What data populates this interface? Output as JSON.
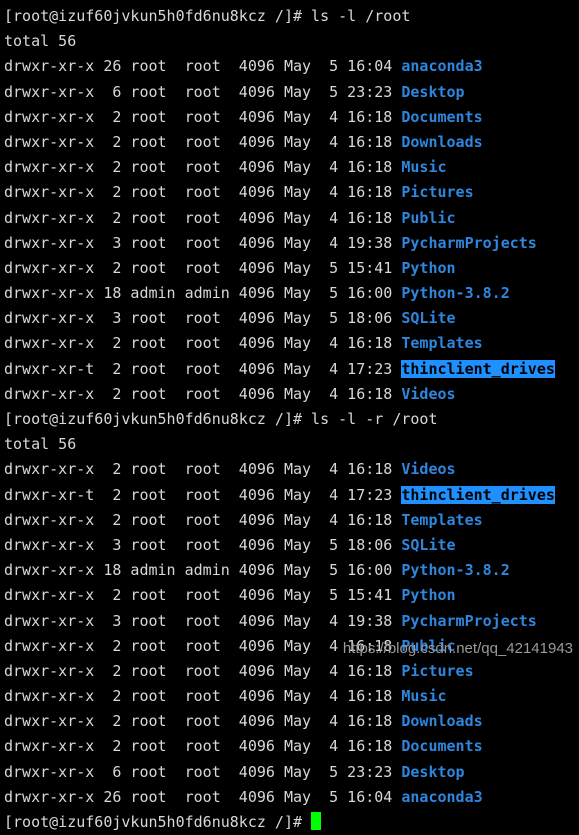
{
  "terminal": {
    "background_color": "#000000",
    "foreground_color": "#d8d8d8",
    "dir_color": "#2e86de",
    "sticky_bg_color": "#1e90ff",
    "sticky_fg_color": "#000000",
    "cursor_color": "#00ff00",
    "prompt": "[root@izuf60jvkun5h0fd6nu8kcz /]# ",
    "commands": {
      "first": "ls -l /root",
      "second": "ls -l -r /root"
    },
    "totals": {
      "first": "total 56",
      "second": "total 56"
    },
    "listing_one": [
      {
        "perms": "drwxr-xr-x",
        "links": "26",
        "owner": "root ",
        "group": "root ",
        "size": "4096",
        "month": "May",
        "day": " 5",
        "time": "16:04",
        "name": "anaconda3",
        "sticky": false
      },
      {
        "perms": "drwxr-xr-x",
        "links": " 6",
        "owner": "root ",
        "group": "root ",
        "size": "4096",
        "month": "May",
        "day": " 5",
        "time": "23:23",
        "name": "Desktop",
        "sticky": false
      },
      {
        "perms": "drwxr-xr-x",
        "links": " 2",
        "owner": "root ",
        "group": "root ",
        "size": "4096",
        "month": "May",
        "day": " 4",
        "time": "16:18",
        "name": "Documents",
        "sticky": false
      },
      {
        "perms": "drwxr-xr-x",
        "links": " 2",
        "owner": "root ",
        "group": "root ",
        "size": "4096",
        "month": "May",
        "day": " 4",
        "time": "16:18",
        "name": "Downloads",
        "sticky": false
      },
      {
        "perms": "drwxr-xr-x",
        "links": " 2",
        "owner": "root ",
        "group": "root ",
        "size": "4096",
        "month": "May",
        "day": " 4",
        "time": "16:18",
        "name": "Music",
        "sticky": false
      },
      {
        "perms": "drwxr-xr-x",
        "links": " 2",
        "owner": "root ",
        "group": "root ",
        "size": "4096",
        "month": "May",
        "day": " 4",
        "time": "16:18",
        "name": "Pictures",
        "sticky": false
      },
      {
        "perms": "drwxr-xr-x",
        "links": " 2",
        "owner": "root ",
        "group": "root ",
        "size": "4096",
        "month": "May",
        "day": " 4",
        "time": "16:18",
        "name": "Public",
        "sticky": false
      },
      {
        "perms": "drwxr-xr-x",
        "links": " 3",
        "owner": "root ",
        "group": "root ",
        "size": "4096",
        "month": "May",
        "day": " 4",
        "time": "19:38",
        "name": "PycharmProjects",
        "sticky": false
      },
      {
        "perms": "drwxr-xr-x",
        "links": " 2",
        "owner": "root ",
        "group": "root ",
        "size": "4096",
        "month": "May",
        "day": " 5",
        "time": "15:41",
        "name": "Python",
        "sticky": false
      },
      {
        "perms": "drwxr-xr-x",
        "links": "18",
        "owner": "admin",
        "group": "admin",
        "size": "4096",
        "month": "May",
        "day": " 5",
        "time": "16:00",
        "name": "Python-3.8.2",
        "sticky": false
      },
      {
        "perms": "drwxr-xr-x",
        "links": " 3",
        "owner": "root ",
        "group": "root ",
        "size": "4096",
        "month": "May",
        "day": " 5",
        "time": "18:06",
        "name": "SQLite",
        "sticky": false
      },
      {
        "perms": "drwxr-xr-x",
        "links": " 2",
        "owner": "root ",
        "group": "root ",
        "size": "4096",
        "month": "May",
        "day": " 4",
        "time": "16:18",
        "name": "Templates",
        "sticky": false
      },
      {
        "perms": "drwxr-xr-t",
        "links": " 2",
        "owner": "root ",
        "group": "root ",
        "size": "4096",
        "month": "May",
        "day": " 4",
        "time": "17:23",
        "name": "thinclient_drives",
        "sticky": true
      },
      {
        "perms": "drwxr-xr-x",
        "links": " 2",
        "owner": "root ",
        "group": "root ",
        "size": "4096",
        "month": "May",
        "day": " 4",
        "time": "16:18",
        "name": "Videos",
        "sticky": false
      }
    ],
    "listing_two": [
      {
        "perms": "drwxr-xr-x",
        "links": " 2",
        "owner": "root ",
        "group": "root ",
        "size": "4096",
        "month": "May",
        "day": " 4",
        "time": "16:18",
        "name": "Videos",
        "sticky": false
      },
      {
        "perms": "drwxr-xr-t",
        "links": " 2",
        "owner": "root ",
        "group": "root ",
        "size": "4096",
        "month": "May",
        "day": " 4",
        "time": "17:23",
        "name": "thinclient_drives",
        "sticky": true
      },
      {
        "perms": "drwxr-xr-x",
        "links": " 2",
        "owner": "root ",
        "group": "root ",
        "size": "4096",
        "month": "May",
        "day": " 4",
        "time": "16:18",
        "name": "Templates",
        "sticky": false
      },
      {
        "perms": "drwxr-xr-x",
        "links": " 3",
        "owner": "root ",
        "group": "root ",
        "size": "4096",
        "month": "May",
        "day": " 5",
        "time": "18:06",
        "name": "SQLite",
        "sticky": false
      },
      {
        "perms": "drwxr-xr-x",
        "links": "18",
        "owner": "admin",
        "group": "admin",
        "size": "4096",
        "month": "May",
        "day": " 5",
        "time": "16:00",
        "name": "Python-3.8.2",
        "sticky": false
      },
      {
        "perms": "drwxr-xr-x",
        "links": " 2",
        "owner": "root ",
        "group": "root ",
        "size": "4096",
        "month": "May",
        "day": " 5",
        "time": "15:41",
        "name": "Python",
        "sticky": false
      },
      {
        "perms": "drwxr-xr-x",
        "links": " 3",
        "owner": "root ",
        "group": "root ",
        "size": "4096",
        "month": "May",
        "day": " 4",
        "time": "19:38",
        "name": "PycharmProjects",
        "sticky": false
      },
      {
        "perms": "drwxr-xr-x",
        "links": " 2",
        "owner": "root ",
        "group": "root ",
        "size": "4096",
        "month": "May",
        "day": " 4",
        "time": "16:18",
        "name": "Public",
        "sticky": false
      },
      {
        "perms": "drwxr-xr-x",
        "links": " 2",
        "owner": "root ",
        "group": "root ",
        "size": "4096",
        "month": "May",
        "day": " 4",
        "time": "16:18",
        "name": "Pictures",
        "sticky": false
      },
      {
        "perms": "drwxr-xr-x",
        "links": " 2",
        "owner": "root ",
        "group": "root ",
        "size": "4096",
        "month": "May",
        "day": " 4",
        "time": "16:18",
        "name": "Music",
        "sticky": false
      },
      {
        "perms": "drwxr-xr-x",
        "links": " 2",
        "owner": "root ",
        "group": "root ",
        "size": "4096",
        "month": "May",
        "day": " 4",
        "time": "16:18",
        "name": "Downloads",
        "sticky": false
      },
      {
        "perms": "drwxr-xr-x",
        "links": " 2",
        "owner": "root ",
        "group": "root ",
        "size": "4096",
        "month": "May",
        "day": " 4",
        "time": "16:18",
        "name": "Documents",
        "sticky": false
      },
      {
        "perms": "drwxr-xr-x",
        "links": " 6",
        "owner": "root ",
        "group": "root ",
        "size": "4096",
        "month": "May",
        "day": " 5",
        "time": "23:23",
        "name": "Desktop",
        "sticky": false
      },
      {
        "perms": "drwxr-xr-x",
        "links": "26",
        "owner": "root ",
        "group": "root ",
        "size": "4096",
        "month": "May",
        "day": " 5",
        "time": "16:04",
        "name": "anaconda3",
        "sticky": false
      }
    ]
  },
  "watermark": {
    "text": "https://blog.csdn.net/qq_42141943"
  }
}
